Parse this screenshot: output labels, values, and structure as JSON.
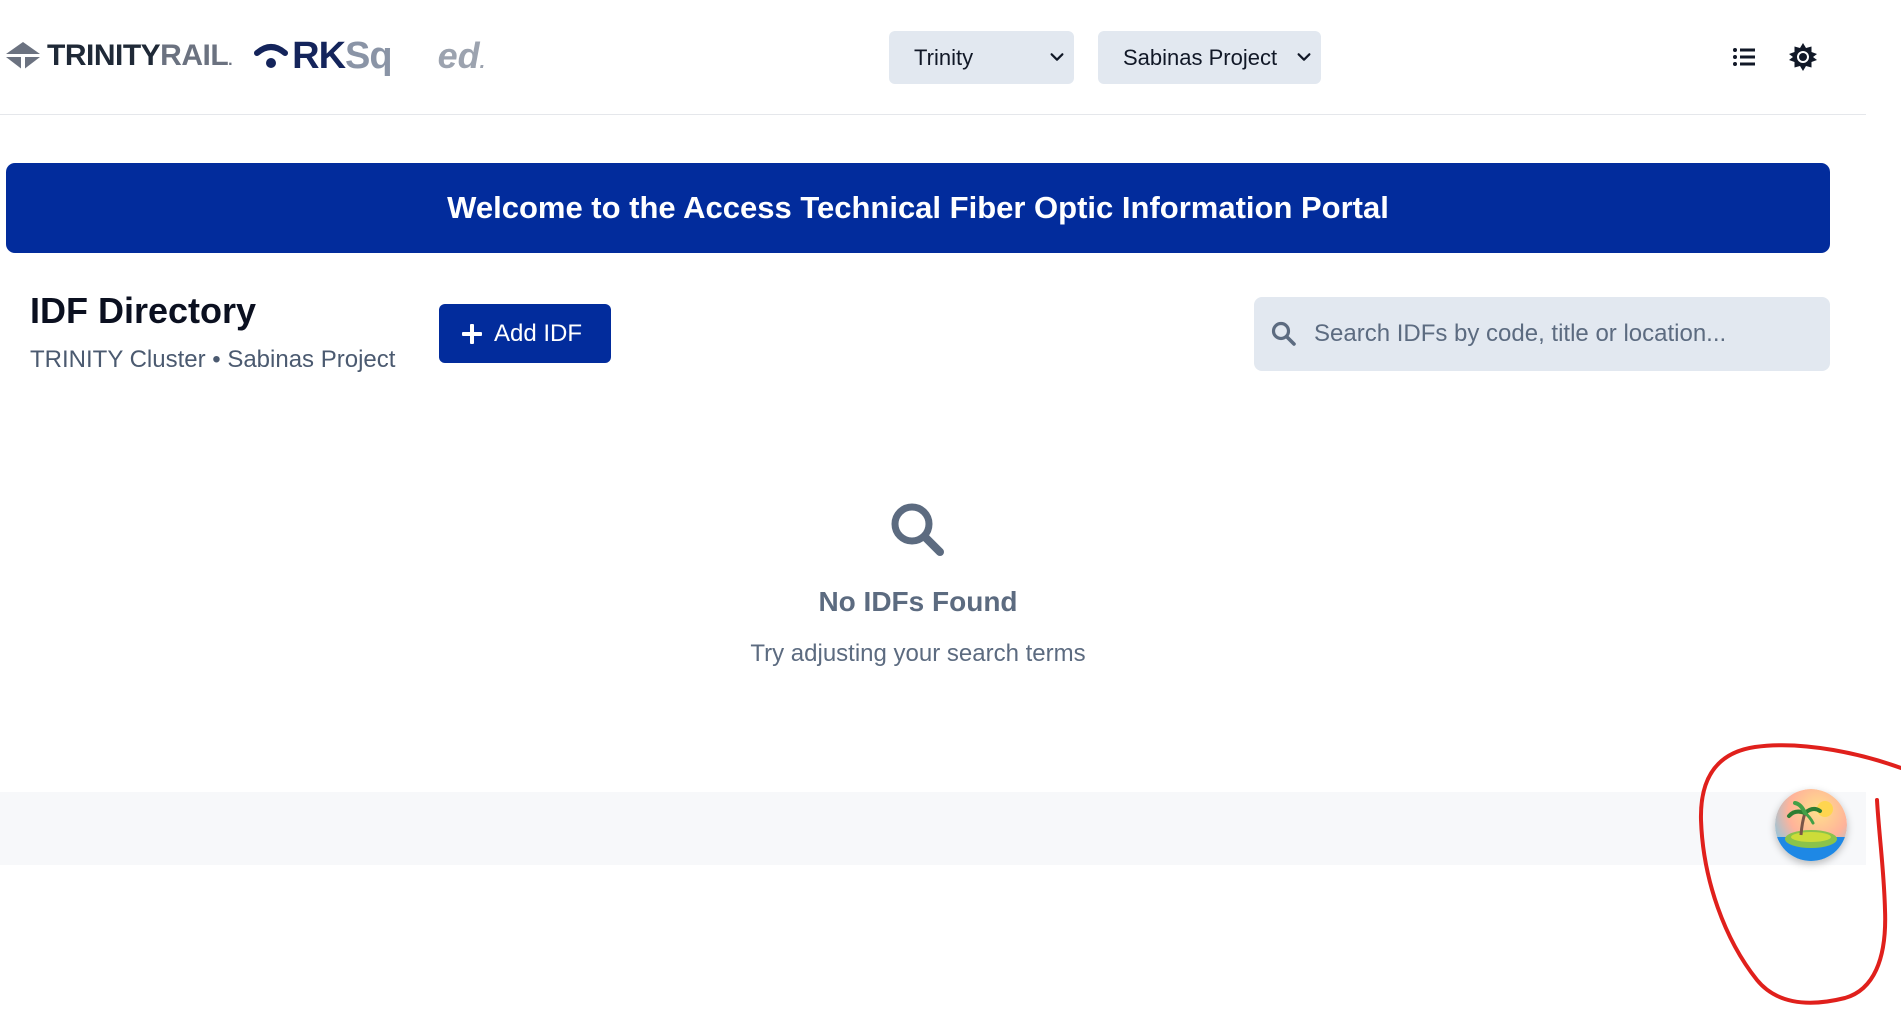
{
  "header": {
    "logos": {
      "trinity_dark": "TRINITY",
      "trinity_light": "RAIL",
      "rksq_rk": "RK",
      "rksq_sq": "Sq",
      "ed": "ed",
      "trademark_dot": "."
    },
    "cluster_select": {
      "value": "Trinity"
    },
    "project_select": {
      "value": "Sabinas Project"
    },
    "icons": [
      "list-icon",
      "theme-sun-icon"
    ]
  },
  "banner": {
    "text": "Welcome to the Access Technical Fiber Optic Information Portal"
  },
  "directory": {
    "title": "IDF Directory",
    "subtitle": "TRINITY Cluster • Sabinas Project",
    "add_button_label": "Add IDF",
    "search_placeholder": "Search IDFs by code, title or location..."
  },
  "empty_state": {
    "title": "No IDFs Found",
    "message": "Try adjusting your search terms"
  },
  "colors": {
    "primary": "#022c9c",
    "input_bg": "#e2e8f0",
    "muted_text": "#5c6b80",
    "annotation": "#e0201c"
  }
}
